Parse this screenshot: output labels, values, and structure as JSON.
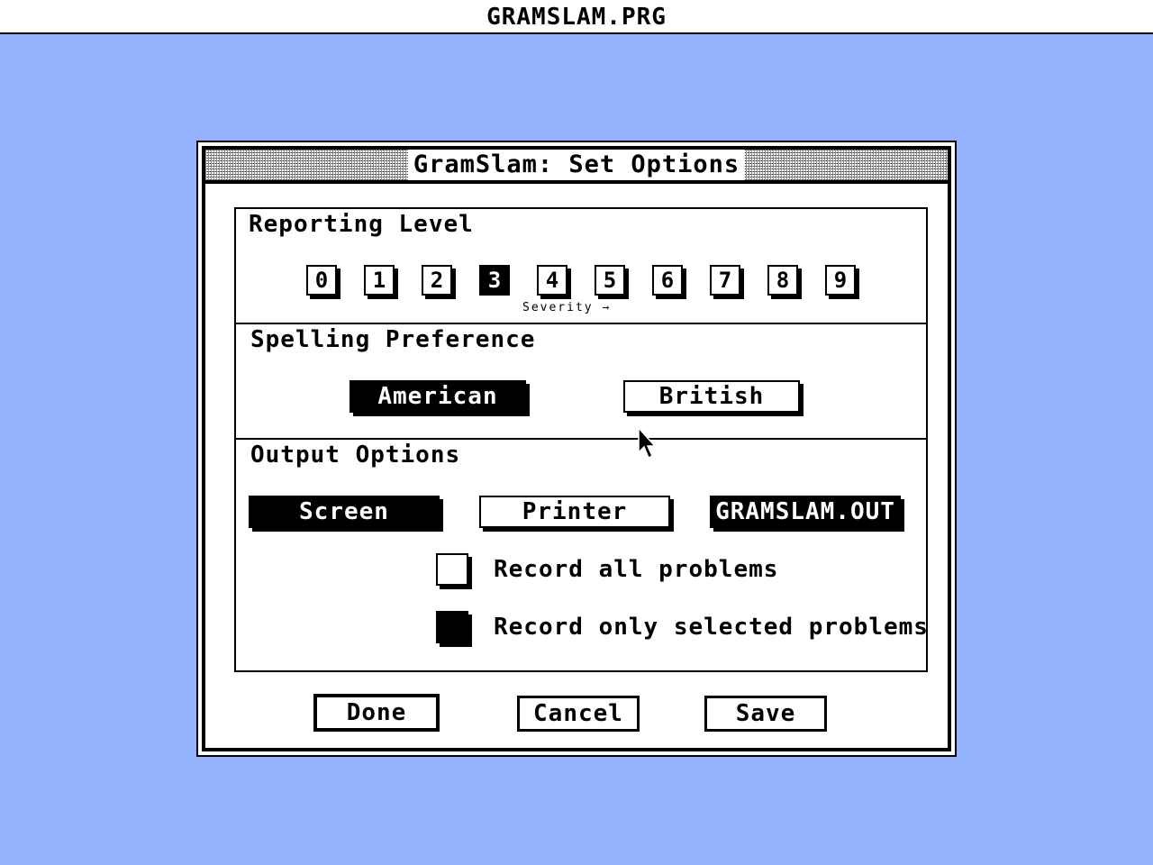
{
  "app": {
    "title": "GRAMSLAM.PRG"
  },
  "dialog": {
    "title": "GramSlam: Set Options",
    "reporting": {
      "label": "Reporting Level",
      "levels": [
        "0",
        "1",
        "2",
        "3",
        "4",
        "5",
        "6",
        "7",
        "8",
        "9"
      ],
      "selected": "3",
      "severity_caption": "Severity →"
    },
    "spelling": {
      "label": "Spelling Preference",
      "options": [
        "American",
        "British"
      ],
      "selected": "American"
    },
    "output": {
      "label": "Output Options",
      "options": [
        "Screen",
        "Printer",
        "GRAMSLAM.OUT"
      ],
      "selected": [
        "Screen",
        "GRAMSLAM.OUT"
      ],
      "record_all_label": "Record all problems",
      "record_all_checked": false,
      "record_selected_label": "Record only selected problems",
      "record_selected_checked": true
    },
    "buttons": {
      "done": "Done",
      "cancel": "Cancel",
      "save": "Save"
    }
  },
  "colors": {
    "desktop": "#95b3fc",
    "window": "#ffffff",
    "ink": "#000000"
  }
}
